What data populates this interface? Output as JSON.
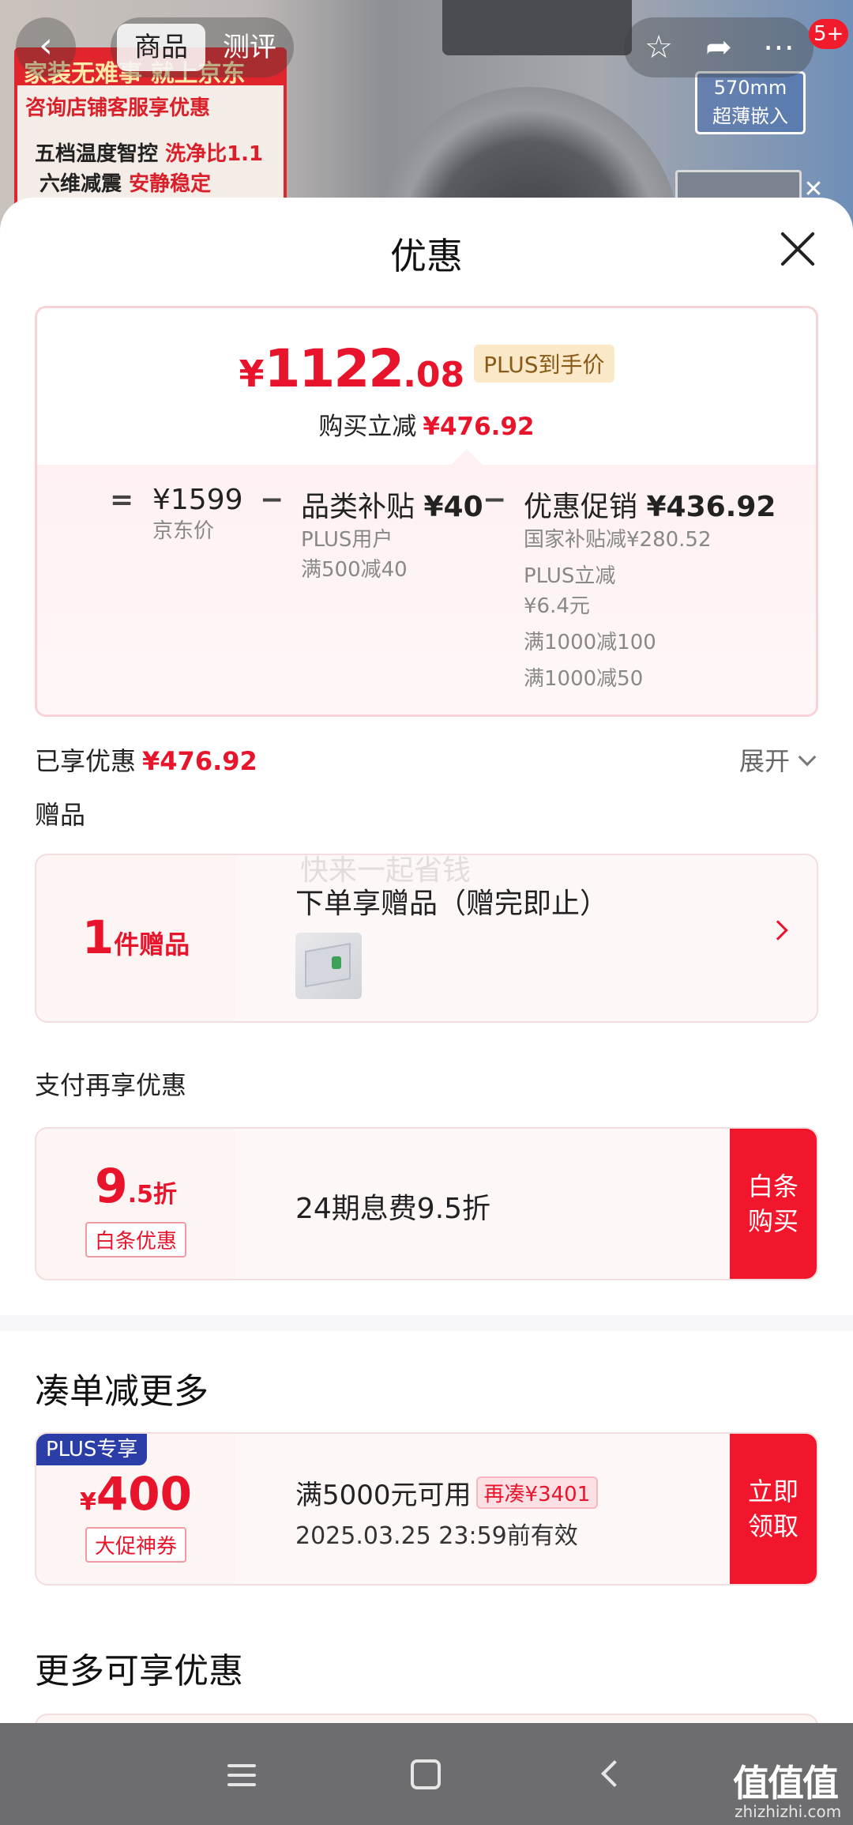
{
  "background": {
    "promo_line1": "家装无难事 就上京东",
    "promo_line2": "咨询店铺客服享优惠",
    "promo_line3a": "五档温度智控",
    "promo_line3b": "洗净比1.1",
    "promo_line4a": "六维减震",
    "promo_line4b": "安静稳定",
    "badge_line1": "570mm",
    "badge_line2": "超薄嵌入"
  },
  "topnav": {
    "back_icon": "chevron-left-icon",
    "tabs": [
      {
        "label": "商品"
      },
      {
        "label": "测评"
      }
    ],
    "icons": [
      "star-icon",
      "share-icon",
      "more-icon"
    ],
    "message_badge": "5+"
  },
  "sheet": {
    "title": "优惠"
  },
  "price_card": {
    "currency": "¥",
    "price_int": "1122",
    "price_dec": ".08",
    "plus_tag": "PLUS到手价",
    "instant_label": "购买立减",
    "instant_value": "¥476.92",
    "equals": "=",
    "minus": "−",
    "base_value": "¥1599",
    "base_label": "京东价",
    "subsidy_title": "品类补贴",
    "subsidy_value": "¥40",
    "subsidy_sub1": "PLUS用户",
    "subsidy_sub2": "满500减40",
    "promo_title": "优惠促销",
    "promo_value": "¥436.92",
    "promo_items": [
      "国家补贴减¥280.52",
      "PLUS立减",
      "¥6.4元",
      "满1000减100",
      "满1000减50"
    ]
  },
  "enjoyed": {
    "label": "已享优惠",
    "value": "¥476.92",
    "expand_label": "展开"
  },
  "gifts": {
    "section_label": "赠品",
    "count": "1",
    "count_unit": "件赠品",
    "title": "下单享赠品（赠完即止）"
  },
  "pay": {
    "section_label": "支付再享优惠",
    "rate_big": "9",
    "rate_small": ".5折",
    "tag": "白条优惠",
    "desc": "24期息费9.5折",
    "button_line1": "白条",
    "button_line2": "购买"
  },
  "bundle": {
    "title": "凑单减更多",
    "plus_label": "PLUS专享",
    "currency": "¥",
    "amount": "400",
    "tag": "大促神券",
    "condition": "满5000元可用",
    "gap_pill": "再凑¥3401",
    "expiry": "2025.03.25 23:59前有效",
    "button_line1": "立即",
    "button_line2": "领取"
  },
  "more": {
    "title": "更多可享优惠"
  },
  "watermark": "快来一起省钱",
  "system_bar": {
    "brand": "值值值",
    "brand_sub": "zhizhizhi.com"
  }
}
